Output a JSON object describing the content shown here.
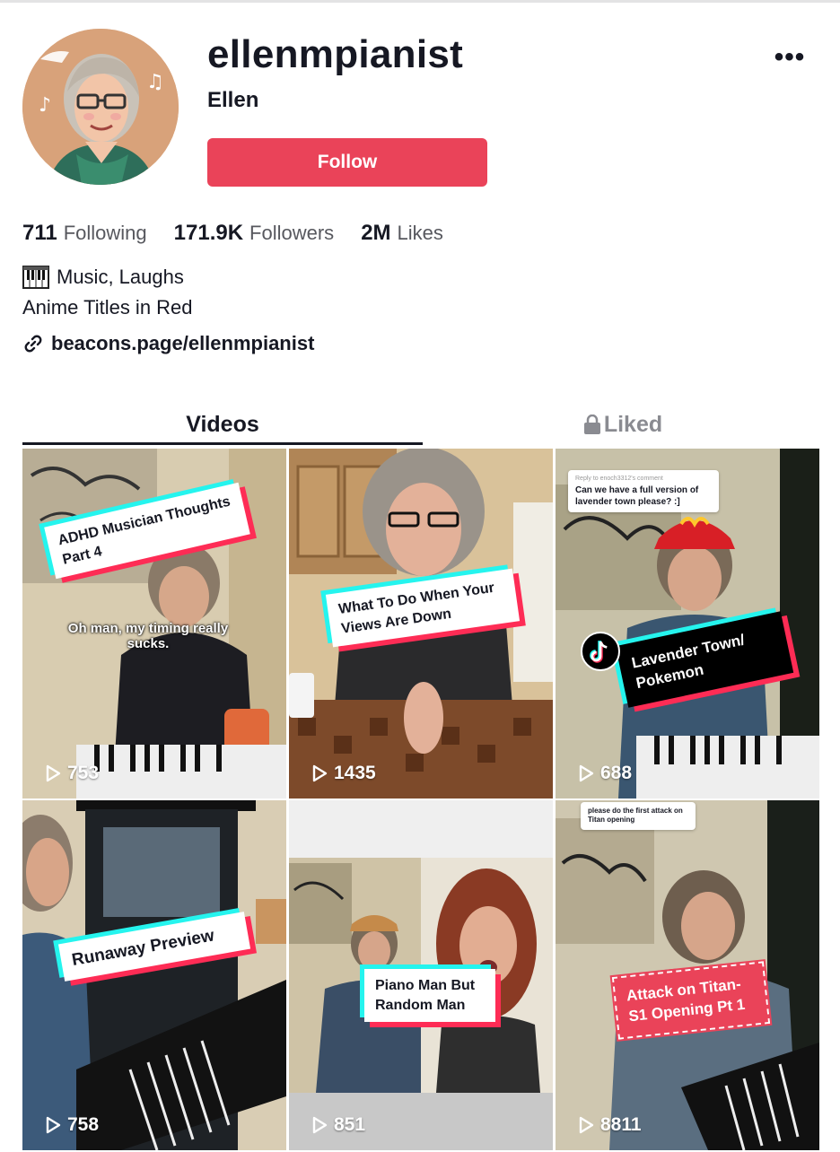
{
  "profile": {
    "username": "ellenmpianist",
    "nickname": "Ellen",
    "follow_label": "Follow",
    "more_label": "•••"
  },
  "stats": {
    "following_count": "711",
    "following_label": "Following",
    "followers_count": "171.9K",
    "followers_label": "Followers",
    "likes_count": "2M",
    "likes_label": "Likes"
  },
  "bio": {
    "line1": "Music, Laughs",
    "line2": "Anime Titles in Red",
    "link": "beacons.page/ellenmpianist"
  },
  "tabs": {
    "videos": "Videos",
    "liked": "Liked"
  },
  "videos": [
    {
      "caption": "ADHD Musician Thoughts Part 4",
      "overlay": "Oh man, my timing really sucks.",
      "views": "753"
    },
    {
      "caption": "What To Do When Your Views Are Down",
      "views": "1435"
    },
    {
      "caption": "Lavender Town/ Pokemon",
      "reply_title": "Reply to enoch3312's comment",
      "reply_text": "Can we have a full version of lavender town please? :]",
      "views": "688"
    },
    {
      "caption": "Runaway Preview",
      "views": "758"
    },
    {
      "caption": "Piano Man But Random Man",
      "views": "851"
    },
    {
      "caption": "Attack on Titan- S1 Opening Pt 1",
      "reply_text": "please do the first attack on Titan opening",
      "views": "8811"
    }
  ],
  "colors": {
    "follow": "#ea4359",
    "accent_cyan": "#25f4ee",
    "accent_pink": "#fe2c55",
    "text_primary": "#161823",
    "text_secondary": "#57585e"
  }
}
